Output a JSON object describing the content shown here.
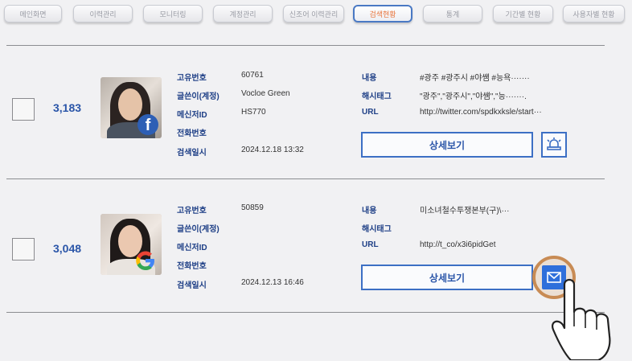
{
  "nav": {
    "tabs": [
      {
        "label": "메인화면",
        "active": false
      },
      {
        "label": "이력관리",
        "active": false
      },
      {
        "label": "모니터링",
        "active": false
      },
      {
        "label": "계정관리",
        "active": false
      },
      {
        "label": "신조어 이력관리",
        "active": false
      },
      {
        "label": "검색현황",
        "active": true
      },
      {
        "label": "통계",
        "active": false
      },
      {
        "label": "기간별 현황",
        "active": false
      },
      {
        "label": "사용자별 현황",
        "active": false
      }
    ]
  },
  "labels": {
    "id": "고유번호",
    "author": "글쓴이(계정)",
    "messenger": "메신저ID",
    "phone": "전화번호",
    "search_time": "검색일시",
    "content": "내용",
    "hashtag": "해시태그",
    "url": "URL",
    "detail_button": "상세보기"
  },
  "results": [
    {
      "score": "3,183",
      "platform_icon": "facebook-icon",
      "id": "60761",
      "author": "Vocloe Green",
      "messenger": "HS770",
      "phone": "",
      "search_time": "2024.12.18  13:32",
      "content": "#광주 #광주시 #야썜 #능욕·······",
      "hashtag": "\"광주\",\"광주시\",\"야썜\",\"능·······.",
      "url": "http://twitter.com/spdkxksle/start···",
      "action_icon": "alarm-icon"
    },
    {
      "score": "3,048",
      "platform_icon": "google-icon",
      "id": "50859",
      "author": "",
      "messenger": "",
      "phone": "",
      "search_time": "2024.12.13  16:46",
      "content": "미소녀철수투쟁본부(구)\\···",
      "hashtag": "",
      "url": "http://t_co/x3i6pidGet",
      "action_icon": "mail-icon"
    }
  ],
  "colors": {
    "accent": "#2a55a8",
    "active_tab_text": "#e8733a",
    "label": "#1e3f86",
    "facebook": "#2d5fb5",
    "mail_button": "#2f6fdb"
  }
}
